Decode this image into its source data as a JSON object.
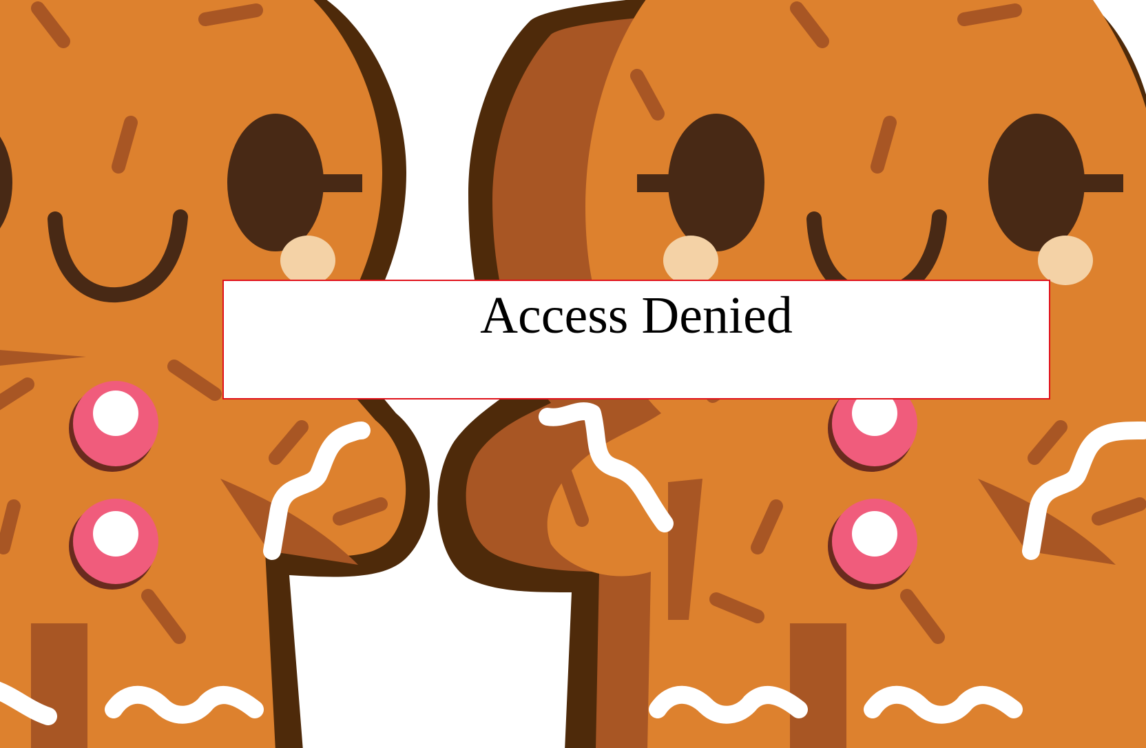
{
  "page": {
    "background_image": "gingerbread-cookies-illustration"
  },
  "dialog": {
    "title": "Access Denied",
    "border_color": "#e0101a"
  },
  "palette": {
    "outline": "#4e2a0a",
    "cookie": "#dd812e",
    "shade": "#a85624",
    "eye": "#482915",
    "cheek": "#f4d2a6",
    "button": "#f05c7c",
    "icing": "#ffffff"
  }
}
